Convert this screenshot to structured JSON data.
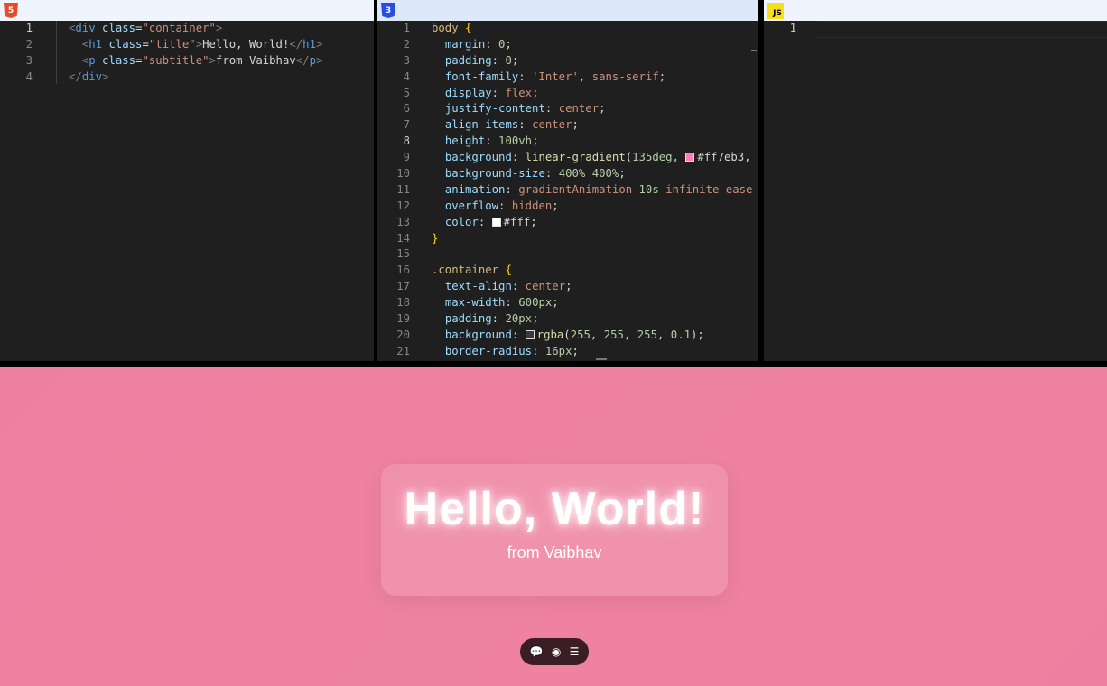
{
  "html_pane": {
    "icon": "html5-icon",
    "icon_label": "5",
    "active_line": 1,
    "lines": [
      {
        "n": "1",
        "segs": [
          [
            "br",
            "<"
          ],
          [
            "tag",
            "div"
          ],
          [
            "pun",
            " "
          ],
          [
            "attr",
            "class"
          ],
          [
            "pun",
            "="
          ],
          [
            "str",
            "\"container\""
          ],
          [
            "br",
            ">"
          ]
        ]
      },
      {
        "n": "2",
        "segs": [
          [
            "pun",
            "  "
          ],
          [
            "br",
            "<"
          ],
          [
            "tag",
            "h1"
          ],
          [
            "pun",
            " "
          ],
          [
            "attr",
            "class"
          ],
          [
            "pun",
            "="
          ],
          [
            "str",
            "\"title\""
          ],
          [
            "br",
            ">"
          ],
          [
            "text",
            "Hello, World!"
          ],
          [
            "br",
            "</"
          ],
          [
            "tag",
            "h1"
          ],
          [
            "br",
            ">"
          ]
        ]
      },
      {
        "n": "3",
        "segs": [
          [
            "pun",
            "  "
          ],
          [
            "br",
            "<"
          ],
          [
            "tag",
            "p"
          ],
          [
            "pun",
            " "
          ],
          [
            "attr",
            "class"
          ],
          [
            "pun",
            "="
          ],
          [
            "str",
            "\"subtitle\""
          ],
          [
            "br",
            ">"
          ],
          [
            "text",
            "from Vaibhav"
          ],
          [
            "br",
            "</"
          ],
          [
            "tag",
            "p"
          ],
          [
            "br",
            ">"
          ]
        ]
      },
      {
        "n": "4",
        "segs": [
          [
            "br",
            "</"
          ],
          [
            "tag",
            "div"
          ],
          [
            "br",
            ">"
          ]
        ]
      }
    ]
  },
  "css_pane": {
    "icon": "css3-icon",
    "icon_label": "3",
    "active_line": 8,
    "lines": [
      {
        "n": "1",
        "segs": [
          [
            "sel",
            "body"
          ],
          [
            "pun",
            " "
          ],
          [
            "brace",
            "{"
          ]
        ]
      },
      {
        "n": "2",
        "segs": [
          [
            "pun",
            "  "
          ],
          [
            "prop",
            "margin"
          ],
          [
            "pun",
            ": "
          ],
          [
            "num",
            "0"
          ],
          [
            "pun",
            ";"
          ]
        ]
      },
      {
        "n": "3",
        "segs": [
          [
            "pun",
            "  "
          ],
          [
            "prop",
            "padding"
          ],
          [
            "pun",
            ": "
          ],
          [
            "num",
            "0"
          ],
          [
            "pun",
            ";"
          ]
        ]
      },
      {
        "n": "4",
        "segs": [
          [
            "pun",
            "  "
          ],
          [
            "prop",
            "font-family"
          ],
          [
            "pun",
            ": "
          ],
          [
            "val",
            "'Inter'"
          ],
          [
            "pun",
            ", "
          ],
          [
            "val",
            "sans-serif"
          ],
          [
            "pun",
            ";"
          ]
        ]
      },
      {
        "n": "5",
        "segs": [
          [
            "pun",
            "  "
          ],
          [
            "prop",
            "display"
          ],
          [
            "pun",
            ": "
          ],
          [
            "val",
            "flex"
          ],
          [
            "pun",
            ";"
          ]
        ]
      },
      {
        "n": "6",
        "segs": [
          [
            "pun",
            "  "
          ],
          [
            "prop",
            "justify-content"
          ],
          [
            "pun",
            ": "
          ],
          [
            "val",
            "center"
          ],
          [
            "pun",
            ";"
          ]
        ]
      },
      {
        "n": "7",
        "segs": [
          [
            "pun",
            "  "
          ],
          [
            "prop",
            "align-items"
          ],
          [
            "pun",
            ": "
          ],
          [
            "val",
            "center"
          ],
          [
            "pun",
            ";"
          ]
        ]
      },
      {
        "n": "8",
        "segs": [
          [
            "pun",
            "  "
          ],
          [
            "prop",
            "height"
          ],
          [
            "pun",
            ": "
          ],
          [
            "num",
            "100vh"
          ],
          [
            "pun",
            ";"
          ]
        ]
      },
      {
        "n": "9",
        "segs": [
          [
            "pun",
            "  "
          ],
          [
            "prop",
            "background"
          ],
          [
            "pun",
            ": "
          ],
          [
            "fn",
            "linear-gradient"
          ],
          [
            "pun",
            "("
          ],
          [
            "num",
            "135deg"
          ],
          [
            "pun",
            ", "
          ],
          [
            "swatch",
            "#ff7eb3"
          ],
          [
            "pun",
            "#ff7eb3, "
          ],
          [
            "swatch",
            "#ff7eb3"
          ]
        ]
      },
      {
        "n": "10",
        "segs": [
          [
            "pun",
            "  "
          ],
          [
            "prop",
            "background-size"
          ],
          [
            "pun",
            ": "
          ],
          [
            "num",
            "400% 400%"
          ],
          [
            "pun",
            ";"
          ]
        ]
      },
      {
        "n": "11",
        "segs": [
          [
            "pun",
            "  "
          ],
          [
            "prop",
            "animation"
          ],
          [
            "pun",
            ": "
          ],
          [
            "val",
            "gradientAnimation"
          ],
          [
            "pun",
            " "
          ],
          [
            "num",
            "10s"
          ],
          [
            "pun",
            " "
          ],
          [
            "val",
            "infinite ease-i"
          ]
        ]
      },
      {
        "n": "12",
        "segs": [
          [
            "pun",
            "  "
          ],
          [
            "prop",
            "overflow"
          ],
          [
            "pun",
            ": "
          ],
          [
            "val",
            "hidden"
          ],
          [
            "pun",
            ";"
          ]
        ]
      },
      {
        "n": "13",
        "segs": [
          [
            "pun",
            "  "
          ],
          [
            "prop",
            "color"
          ],
          [
            "pun",
            ": "
          ],
          [
            "swatch",
            "#ffffff"
          ],
          [
            "pun",
            "#fff;"
          ]
        ]
      },
      {
        "n": "14",
        "segs": [
          [
            "brace",
            "}"
          ]
        ]
      },
      {
        "n": "15",
        "segs": []
      },
      {
        "n": "16",
        "segs": [
          [
            "sel",
            ".container"
          ],
          [
            "pun",
            " "
          ],
          [
            "brace",
            "{"
          ]
        ]
      },
      {
        "n": "17",
        "segs": [
          [
            "pun",
            "  "
          ],
          [
            "prop",
            "text-align"
          ],
          [
            "pun",
            ": "
          ],
          [
            "val",
            "center"
          ],
          [
            "pun",
            ";"
          ]
        ]
      },
      {
        "n": "18",
        "segs": [
          [
            "pun",
            "  "
          ],
          [
            "prop",
            "max-width"
          ],
          [
            "pun",
            ": "
          ],
          [
            "num",
            "600px"
          ],
          [
            "pun",
            ";"
          ]
        ]
      },
      {
        "n": "19",
        "segs": [
          [
            "pun",
            "  "
          ],
          [
            "prop",
            "padding"
          ],
          [
            "pun",
            ": "
          ],
          [
            "num",
            "20px"
          ],
          [
            "pun",
            ";"
          ]
        ]
      },
      {
        "n": "20",
        "segs": [
          [
            "pun",
            "  "
          ],
          [
            "prop",
            "background"
          ],
          [
            "pun",
            ": "
          ],
          [
            "swatch",
            "#3a3a3a"
          ],
          [
            "fn",
            "rgba"
          ],
          [
            "pun",
            "("
          ],
          [
            "num",
            "255"
          ],
          [
            "pun",
            ", "
          ],
          [
            "num",
            "255"
          ],
          [
            "pun",
            ", "
          ],
          [
            "num",
            "255"
          ],
          [
            "pun",
            ", "
          ],
          [
            "num",
            "0.1"
          ],
          [
            "pun",
            ");"
          ]
        ]
      },
      {
        "n": "21",
        "segs": [
          [
            "pun",
            "  "
          ],
          [
            "prop",
            "border-radius"
          ],
          [
            "pun",
            ": "
          ],
          [
            "num",
            "16px"
          ],
          [
            "pun",
            ";"
          ]
        ]
      }
    ]
  },
  "js_pane": {
    "icon": "js-icon",
    "icon_label": "JS",
    "active_line": 1,
    "lines": [
      {
        "n": "1",
        "segs": []
      }
    ]
  },
  "preview": {
    "title": "Hello, World!",
    "subtitle": "from Vaibhav",
    "toolbar": {
      "comment_icon": "💬",
      "toggle_icon": "◉",
      "menu_icon": "☰"
    }
  },
  "colors": {
    "preview_bg": "#ef80a0",
    "editor_bg": "#1f1f1f"
  }
}
